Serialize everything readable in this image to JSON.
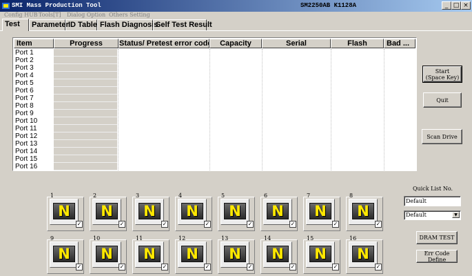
{
  "window": {
    "title": "SMI Mass Production Tool",
    "version": "SM2250AB  K1128A",
    "minimize": "_",
    "maximize": "□",
    "close": "×"
  },
  "menu": [
    "Config HUB",
    "Tools[T]",
    "Dialog Option",
    "Others Setting"
  ],
  "tabs": [
    "Test",
    "Parameter",
    "ID Table",
    "Flash Diagnosis",
    "Self Test Result"
  ],
  "table": {
    "columns": [
      "Item",
      "Progress",
      "Status/ Pretest error code",
      "Capacity",
      "Serial",
      "Flash",
      "Bad ..."
    ],
    "rows": [
      "Port 1",
      "Port 2",
      "Port 3",
      "Port 4",
      "Port 5",
      "Port 6",
      "Port 7",
      "Port 8",
      "Port 9",
      "Port 10",
      "Port 11",
      "Port 12",
      "Port 13",
      "Port 14",
      "Port 15",
      "Port 16"
    ]
  },
  "buttons": {
    "start_line1": "Start",
    "start_line2": "(Space Key)",
    "quit": "Quit",
    "scan_drive": "Scan Drive",
    "dram_test": "DRAM TEST",
    "err_code_define": "Err Code Define"
  },
  "quick_list": {
    "label": "Quick List No.",
    "input_value": "Default",
    "select_value": "Default",
    "select_arrow": "▼"
  },
  "ports": {
    "numbers": [
      "1",
      "2",
      "3",
      "4",
      "5",
      "6",
      "7",
      "8",
      "9",
      "10",
      "11",
      "12",
      "13",
      "14",
      "15",
      "16"
    ],
    "status_letter": "N",
    "status_color": "#ffe800",
    "check_mark": "✓"
  }
}
